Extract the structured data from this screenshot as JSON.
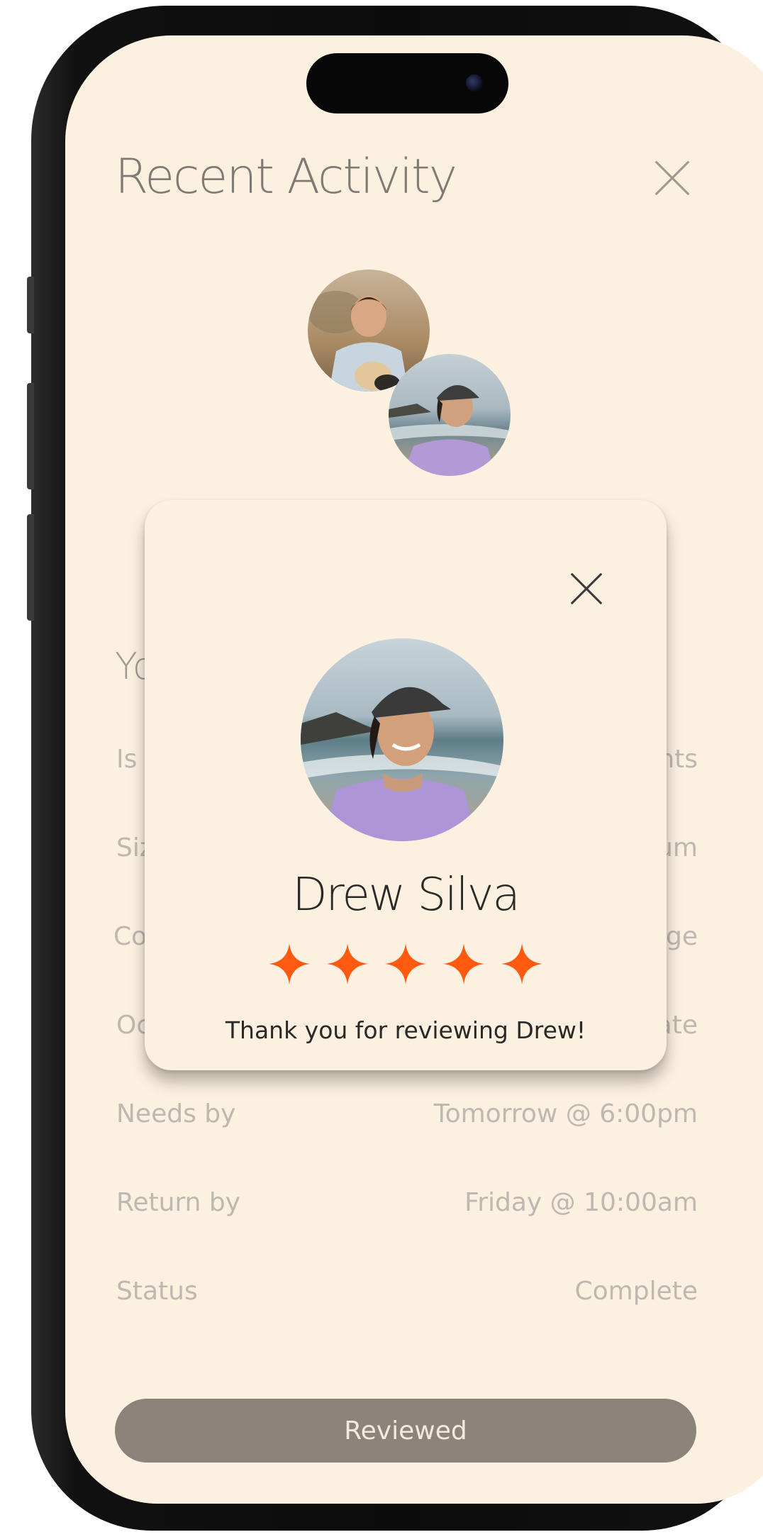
{
  "header": {
    "title": "Recent Activity"
  },
  "details": {
    "heading_partial": "Yo",
    "rows": [
      {
        "label": "Is",
        "value": "nts"
      },
      {
        "label": "Siz",
        "value": "um"
      },
      {
        "label": "Co",
        "value": "nge"
      },
      {
        "label": "Oc",
        "value": "ate"
      },
      {
        "label": "Needs by",
        "value": "Tomorrow @ 6:00pm"
      },
      {
        "label": "Return by",
        "value": "Friday @ 10:00am"
      },
      {
        "label": "Status",
        "value": "Complete"
      }
    ]
  },
  "action_button": {
    "label": "Reviewed"
  },
  "modal": {
    "name": "Drew Silva",
    "rating": 5,
    "max_rating": 5,
    "message": "Thank you for reviewing Drew!"
  },
  "colors": {
    "background": "#fcf0e0",
    "star": "#ff5a10",
    "button": "#8b847b"
  },
  "icons": {
    "close": "close-icon",
    "star": "star-icon"
  }
}
